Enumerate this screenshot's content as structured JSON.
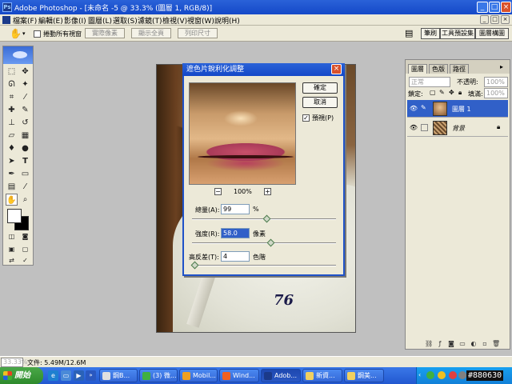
{
  "window": {
    "title": "Adobe Photoshop - [未命名 -5 @ 33.3% (圖層 1, RGB/8)]",
    "app_icon": "Ps",
    "minimize": "_",
    "maximize": "□",
    "close": "×"
  },
  "menu": [
    "檔案(F)",
    "編輯(E)",
    "影像(I)",
    "圖層(L)",
    "選取(S)",
    "濾鏡(T)",
    "檢視(V)",
    "視窗(W)",
    "說明(H)"
  ],
  "options": {
    "scroll_all_windows": "捲動所有視窗",
    "actual_pixels": "實際像素",
    "fit_on_screen": "顯示全頁",
    "print_size": "列印尺寸",
    "tabs": [
      "筆刷",
      "工具預設集",
      "圖層構圖"
    ]
  },
  "dialog": {
    "title": "遮色片銳利化調整",
    "ok": "確定",
    "cancel": "取消",
    "preview_label": "預視(P)",
    "preview_checked": "✓",
    "zoom_out": "−",
    "zoom_in": "+",
    "zoom": "100%",
    "amount_label": "總量(A):",
    "amount_value": "99",
    "amount_unit": "%",
    "radius_label": "強度(R):",
    "radius_value": "58.0",
    "radius_unit": "像素",
    "threshold_label": "高反差(T):",
    "threshold_value": "4",
    "threshold_unit": "色階"
  },
  "sliders": {
    "amount_fraction": 0.52,
    "radius_fraction": 0.55,
    "threshold_fraction": 0.02
  },
  "photo": {
    "jersey_number": "76"
  },
  "layers": {
    "tabs": [
      "圖層",
      "色版",
      "路徑"
    ],
    "blend_mode": "正常",
    "opacity_label": "不透明:",
    "opacity_value": "100%",
    "lock_label": "鎖定:",
    "fill_label": "填滿:",
    "fill_value": "100%",
    "items": [
      {
        "name": "圖層 1",
        "selected": true
      },
      {
        "name": "背景",
        "selected": false
      }
    ]
  },
  "status": {
    "zoom": "33.33%",
    "doc": "文件: 5.49M/12.6M"
  },
  "taskbar": {
    "start": "開始",
    "tasks": [
      "鋼B...",
      "(3) 微...",
      "Mobil...",
      "Wind...",
      "Adob...",
      "新資...",
      "鋼美..."
    ],
    "watermark": "#880630"
  }
}
